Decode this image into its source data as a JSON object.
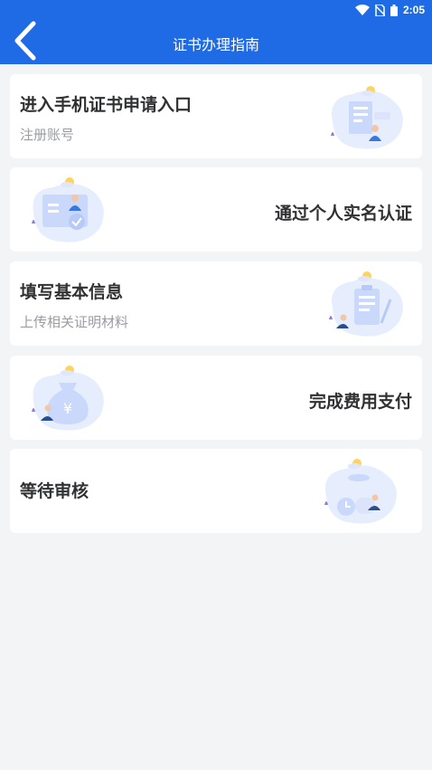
{
  "status_bar": {
    "time": "2:05"
  },
  "header": {
    "title": "证书办理指南"
  },
  "steps": [
    {
      "title": "进入手机证书申请入口",
      "subtitle": "注册账号"
    },
    {
      "title": "通过个人实名认证"
    },
    {
      "title": "填写基本信息",
      "subtitle": "上传相关证明材料"
    },
    {
      "title": "完成费用支付"
    },
    {
      "title": "等待审核"
    }
  ],
  "colors": {
    "primary": "#1f6be6",
    "background": "#f3f4f6",
    "card": "#ffffff"
  }
}
